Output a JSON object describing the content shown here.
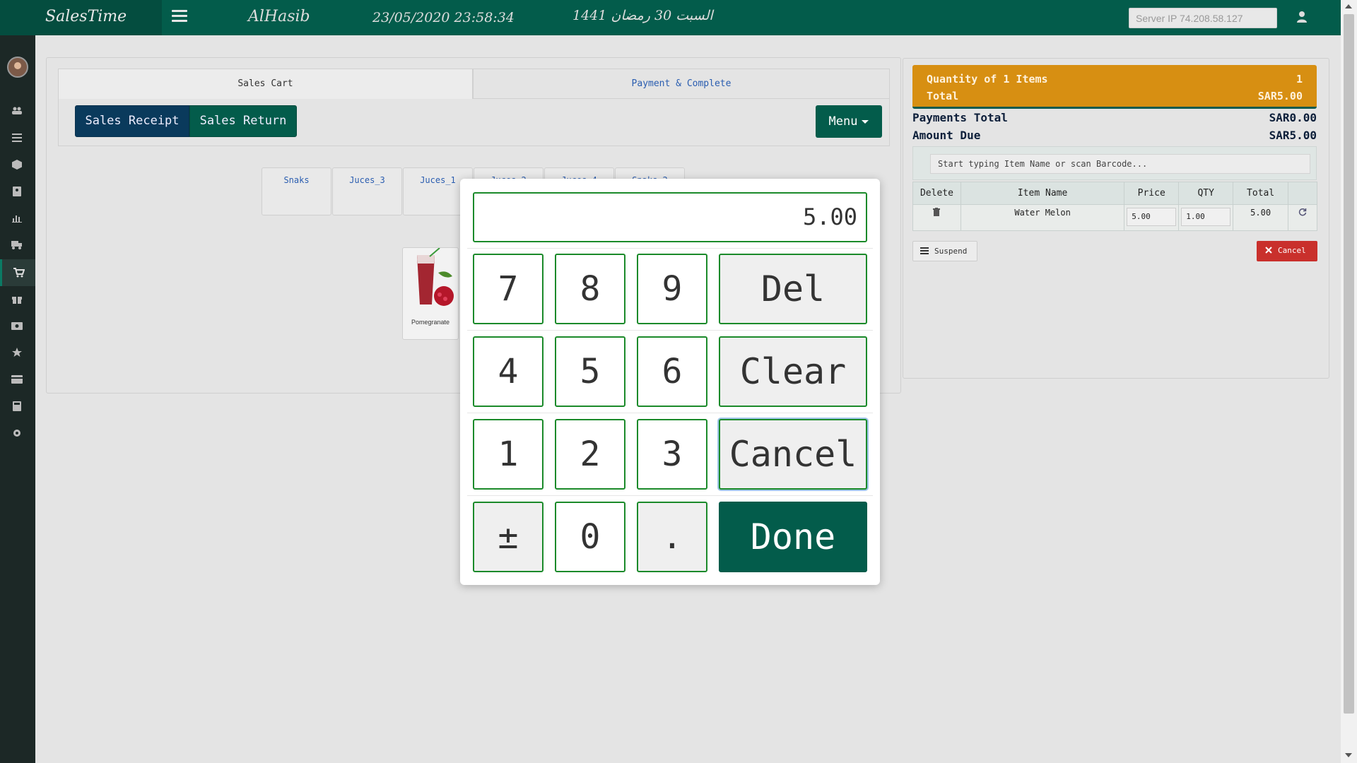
{
  "topbar": {
    "brand": "SalesTime",
    "app_name": "AlHasib",
    "datetime": "23/05/2020 23:58:34",
    "hijri_date": "السبت 30 رمضان 1441",
    "server_ip_placeholder": "Server IP 74.208.58.127"
  },
  "sidebar": {
    "items": [
      "users-icon",
      "list-icon",
      "box-icon",
      "contact-icon",
      "chart-icon",
      "truck-icon",
      "cart-icon",
      "gift-icon",
      "money-icon",
      "star-icon",
      "card-icon",
      "calculator-icon",
      "gear-icon"
    ],
    "active": "cart-icon"
  },
  "tabs": {
    "cart": "Sales Cart",
    "payment": "Payment & Complete"
  },
  "cart_buttons": {
    "receipt": "Sales Receipt",
    "return": "Sales Return",
    "menu": "Menu"
  },
  "categories": [
    "Snaks",
    "Juces_3",
    "Juces_1",
    "Juces_2",
    "Juces_4",
    "Snaks_2"
  ],
  "product": {
    "label": "Pomegranate"
  },
  "summary": {
    "quantity_label": "Quantity of 1 Items",
    "quantity_value": "1",
    "total_label": "Total",
    "total_value": "SAR5.00",
    "payments_label": "Payments Total",
    "payments_value": "SAR0.00",
    "due_label": "Amount Due",
    "due_value": "SAR5.00"
  },
  "search": {
    "placeholder": "Start typing Item Name or scan Barcode..."
  },
  "table": {
    "headers": [
      "Delete",
      "Item Name",
      "Price",
      "QTY",
      "Total",
      ""
    ],
    "rows": [
      {
        "name": "Water Melon",
        "price": "5.00",
        "qty": "1.00",
        "total": "5.00"
      }
    ]
  },
  "actions": {
    "suspend": "Suspend",
    "cancel": "Cancel"
  },
  "keypad": {
    "display": "5.00",
    "keys": {
      "k7": "7",
      "k8": "8",
      "k9": "9",
      "del": "Del",
      "k4": "4",
      "k5": "5",
      "k6": "6",
      "clear": "Clear",
      "k1": "1",
      "k2": "2",
      "k3": "3",
      "cancel": "Cancel",
      "plusminus": "±",
      "k0": "0",
      "dot": ".",
      "done": "Done"
    }
  },
  "colors": {
    "primary": "#035c4b",
    "summary": "#d78f12",
    "danger": "#c9302c",
    "navy": "#0a3a5c"
  }
}
